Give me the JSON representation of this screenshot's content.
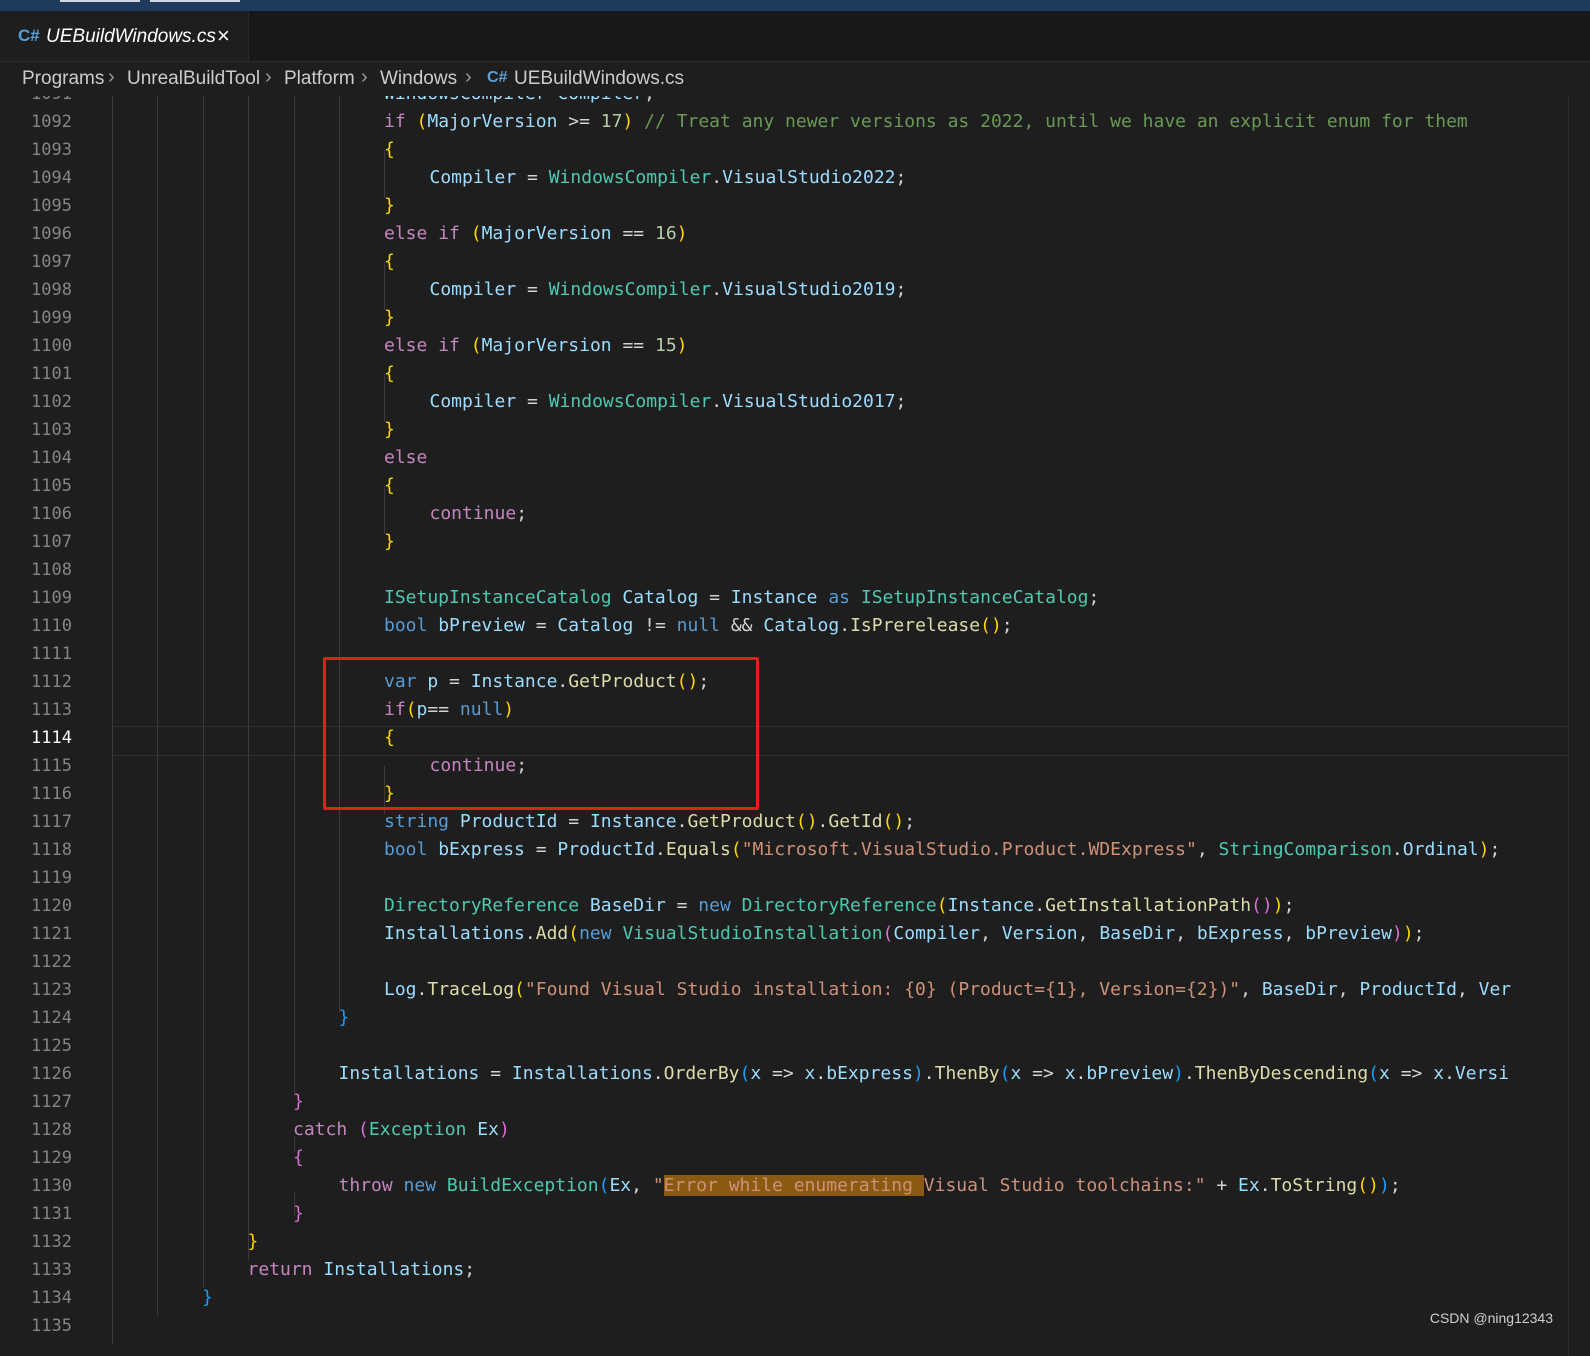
{
  "tab": {
    "name": "UEBuildWindows.cs",
    "language_badge": "C#",
    "close_symbol": "×"
  },
  "breadcrumb": {
    "items": [
      "Programs",
      "UnrealBuildTool",
      "Platform",
      "Windows",
      "UEBuildWindows.cs"
    ],
    "separator": "›",
    "file_badge": "C#"
  },
  "editor": {
    "active_line": 1114,
    "lines": [
      {
        "n": 1091,
        "indent": 0,
        "tokens": [
          [
            "id",
            "WindowsCompiler"
          ],
          [
            "pn",
            " "
          ],
          [
            "id",
            "Compiler"
          ],
          [
            "pn",
            ";"
          ]
        ]
      },
      {
        "n": 1092,
        "indent": 0,
        "tokens": [
          [
            "ctl",
            "if"
          ],
          [
            "pn",
            " "
          ],
          [
            "b1",
            "("
          ],
          [
            "id",
            "MajorVersion"
          ],
          [
            "pn",
            " >= "
          ],
          [
            "num",
            "17"
          ],
          [
            "b1",
            ")"
          ],
          [
            "pn",
            " "
          ],
          [
            "cm",
            "// Treat any newer versions as 2022, until we have an explicit enum for them"
          ]
        ]
      },
      {
        "n": 1093,
        "indent": 0,
        "tokens": [
          [
            "b1",
            "{"
          ]
        ]
      },
      {
        "n": 1094,
        "indent": 1,
        "tokens": [
          [
            "id",
            "Compiler"
          ],
          [
            "pn",
            " = "
          ],
          [
            "ty",
            "WindowsCompiler"
          ],
          [
            "pn",
            "."
          ],
          [
            "id",
            "VisualStudio2022"
          ],
          [
            "pn",
            ";"
          ]
        ]
      },
      {
        "n": 1095,
        "indent": 0,
        "tokens": [
          [
            "b1",
            "}"
          ]
        ]
      },
      {
        "n": 1096,
        "indent": 0,
        "tokens": [
          [
            "ctl",
            "else"
          ],
          [
            "pn",
            " "
          ],
          [
            "ctl",
            "if"
          ],
          [
            "pn",
            " "
          ],
          [
            "b1",
            "("
          ],
          [
            "id",
            "MajorVersion"
          ],
          [
            "pn",
            " == "
          ],
          [
            "num",
            "16"
          ],
          [
            "b1",
            ")"
          ]
        ]
      },
      {
        "n": 1097,
        "indent": 0,
        "tokens": [
          [
            "b1",
            "{"
          ]
        ]
      },
      {
        "n": 1098,
        "indent": 1,
        "tokens": [
          [
            "id",
            "Compiler"
          ],
          [
            "pn",
            " = "
          ],
          [
            "ty",
            "WindowsCompiler"
          ],
          [
            "pn",
            "."
          ],
          [
            "id",
            "VisualStudio2019"
          ],
          [
            "pn",
            ";"
          ]
        ]
      },
      {
        "n": 1099,
        "indent": 0,
        "tokens": [
          [
            "b1",
            "}"
          ]
        ]
      },
      {
        "n": 1100,
        "indent": 0,
        "tokens": [
          [
            "ctl",
            "else"
          ],
          [
            "pn",
            " "
          ],
          [
            "ctl",
            "if"
          ],
          [
            "pn",
            " "
          ],
          [
            "b1",
            "("
          ],
          [
            "id",
            "MajorVersion"
          ],
          [
            "pn",
            " == "
          ],
          [
            "num",
            "15"
          ],
          [
            "b1",
            ")"
          ]
        ]
      },
      {
        "n": 1101,
        "indent": 0,
        "tokens": [
          [
            "b1",
            "{"
          ]
        ]
      },
      {
        "n": 1102,
        "indent": 1,
        "tokens": [
          [
            "id",
            "Compiler"
          ],
          [
            "pn",
            " = "
          ],
          [
            "ty",
            "WindowsCompiler"
          ],
          [
            "pn",
            "."
          ],
          [
            "id",
            "VisualStudio2017"
          ],
          [
            "pn",
            ";"
          ]
        ]
      },
      {
        "n": 1103,
        "indent": 0,
        "tokens": [
          [
            "b1",
            "}"
          ]
        ]
      },
      {
        "n": 1104,
        "indent": 0,
        "tokens": [
          [
            "ctl",
            "else"
          ]
        ]
      },
      {
        "n": 1105,
        "indent": 0,
        "tokens": [
          [
            "b1",
            "{"
          ]
        ]
      },
      {
        "n": 1106,
        "indent": 1,
        "tokens": [
          [
            "ctl",
            "continue"
          ],
          [
            "pn",
            ";"
          ]
        ]
      },
      {
        "n": 1107,
        "indent": 0,
        "tokens": [
          [
            "b1",
            "}"
          ]
        ]
      },
      {
        "n": 1108,
        "indent": 0,
        "tokens": []
      },
      {
        "n": 1109,
        "indent": 0,
        "tokens": [
          [
            "ty",
            "ISetupInstanceCatalog"
          ],
          [
            "pn",
            " "
          ],
          [
            "id",
            "Catalog"
          ],
          [
            "pn",
            " = "
          ],
          [
            "id",
            "Instance"
          ],
          [
            "pn",
            " "
          ],
          [
            "kw",
            "as"
          ],
          [
            "pn",
            " "
          ],
          [
            "ty",
            "ISetupInstanceCatalog"
          ],
          [
            "pn",
            ";"
          ]
        ]
      },
      {
        "n": 1110,
        "indent": 0,
        "tokens": [
          [
            "kw",
            "bool"
          ],
          [
            "pn",
            " "
          ],
          [
            "id",
            "bPreview"
          ],
          [
            "pn",
            " = "
          ],
          [
            "id",
            "Catalog"
          ],
          [
            "pn",
            " != "
          ],
          [
            "kw",
            "null"
          ],
          [
            "pn",
            " && "
          ],
          [
            "id",
            "Catalog"
          ],
          [
            "pn",
            "."
          ],
          [
            "fn",
            "IsPrerelease"
          ],
          [
            "b1",
            "()"
          ],
          [
            "pn",
            ";"
          ]
        ]
      },
      {
        "n": 1111,
        "indent": 0,
        "tokens": []
      },
      {
        "n": 1112,
        "indent": 0,
        "tokens": [
          [
            "kw",
            "var"
          ],
          [
            "pn",
            " "
          ],
          [
            "id",
            "p"
          ],
          [
            "pn",
            " = "
          ],
          [
            "id",
            "Instance"
          ],
          [
            "pn",
            "."
          ],
          [
            "fn",
            "GetProduct"
          ],
          [
            "b1",
            "()"
          ],
          [
            "pn",
            ";"
          ]
        ]
      },
      {
        "n": 1113,
        "indent": 0,
        "tokens": [
          [
            "ctl",
            "if"
          ],
          [
            "b1",
            "("
          ],
          [
            "id",
            "p"
          ],
          [
            "pn",
            "== "
          ],
          [
            "kw",
            "null"
          ],
          [
            "b1",
            ")"
          ]
        ]
      },
      {
        "n": 1114,
        "indent": 0,
        "tokens": [
          [
            "b1",
            "{"
          ]
        ]
      },
      {
        "n": 1115,
        "indent": 1,
        "tokens": [
          [
            "ctl",
            "continue"
          ],
          [
            "pn",
            ";"
          ]
        ]
      },
      {
        "n": 1116,
        "indent": 0,
        "tokens": [
          [
            "b1",
            "}"
          ]
        ]
      },
      {
        "n": 1117,
        "indent": 0,
        "tokens": [
          [
            "kw",
            "string"
          ],
          [
            "pn",
            " "
          ],
          [
            "id",
            "ProductId"
          ],
          [
            "pn",
            " = "
          ],
          [
            "id",
            "Instance"
          ],
          [
            "pn",
            "."
          ],
          [
            "fn",
            "GetProduct"
          ],
          [
            "b1",
            "()"
          ],
          [
            "pn",
            "."
          ],
          [
            "fn",
            "GetId"
          ],
          [
            "b1",
            "()"
          ],
          [
            "pn",
            ";"
          ]
        ]
      },
      {
        "n": 1118,
        "indent": 0,
        "tokens": [
          [
            "kw",
            "bool"
          ],
          [
            "pn",
            " "
          ],
          [
            "id",
            "bExpress"
          ],
          [
            "pn",
            " = "
          ],
          [
            "id",
            "ProductId"
          ],
          [
            "pn",
            "."
          ],
          [
            "fn",
            "Equals"
          ],
          [
            "b1",
            "("
          ],
          [
            "str",
            "\"Microsoft.VisualStudio.Product.WDExpress\""
          ],
          [
            "pn",
            ", "
          ],
          [
            "ty",
            "StringComparison"
          ],
          [
            "pn",
            "."
          ],
          [
            "id",
            "Ordinal"
          ],
          [
            "b1",
            ")"
          ],
          [
            "pn",
            ";"
          ]
        ]
      },
      {
        "n": 1119,
        "indent": 0,
        "tokens": []
      },
      {
        "n": 1120,
        "indent": 0,
        "tokens": [
          [
            "ty",
            "DirectoryReference"
          ],
          [
            "pn",
            " "
          ],
          [
            "id",
            "BaseDir"
          ],
          [
            "pn",
            " = "
          ],
          [
            "kw",
            "new"
          ],
          [
            "pn",
            " "
          ],
          [
            "ty",
            "DirectoryReference"
          ],
          [
            "b1",
            "("
          ],
          [
            "id",
            "Instance"
          ],
          [
            "pn",
            "."
          ],
          [
            "fn",
            "GetInstallationPath"
          ],
          [
            "b2",
            "()"
          ],
          [
            "b1",
            ")"
          ],
          [
            "pn",
            ";"
          ]
        ]
      },
      {
        "n": 1121,
        "indent": 0,
        "tokens": [
          [
            "id",
            "Installations"
          ],
          [
            "pn",
            "."
          ],
          [
            "fn",
            "Add"
          ],
          [
            "b1",
            "("
          ],
          [
            "kw",
            "new"
          ],
          [
            "pn",
            " "
          ],
          [
            "ty",
            "VisualStudioInstallation"
          ],
          [
            "b2",
            "("
          ],
          [
            "id",
            "Compiler"
          ],
          [
            "pn",
            ", "
          ],
          [
            "id",
            "Version"
          ],
          [
            "pn",
            ", "
          ],
          [
            "id",
            "BaseDir"
          ],
          [
            "pn",
            ", "
          ],
          [
            "id",
            "bExpress"
          ],
          [
            "pn",
            ", "
          ],
          [
            "id",
            "bPreview"
          ],
          [
            "b2",
            ")"
          ],
          [
            "b1",
            ")"
          ],
          [
            "pn",
            ";"
          ]
        ]
      },
      {
        "n": 1122,
        "indent": 0,
        "tokens": []
      },
      {
        "n": 1123,
        "indent": 0,
        "tokens": [
          [
            "id",
            "Log"
          ],
          [
            "pn",
            "."
          ],
          [
            "fn",
            "TraceLog"
          ],
          [
            "b1",
            "("
          ],
          [
            "str",
            "\"Found Visual Studio installation: {0} (Product={1}, Version={2})\""
          ],
          [
            "pn",
            ", "
          ],
          [
            "id",
            "BaseDir"
          ],
          [
            "pn",
            ", "
          ],
          [
            "id",
            "ProductId"
          ],
          [
            "pn",
            ", "
          ],
          [
            "id",
            "Ver"
          ]
        ]
      },
      {
        "n": 1124,
        "indent": -1,
        "tokens": [
          [
            "b3",
            "}"
          ]
        ]
      },
      {
        "n": 1125,
        "indent": 0,
        "tokens": []
      },
      {
        "n": 1126,
        "indent": -1,
        "tokens": [
          [
            "id",
            "Installations"
          ],
          [
            "pn",
            " = "
          ],
          [
            "id",
            "Installations"
          ],
          [
            "pn",
            "."
          ],
          [
            "fn",
            "OrderBy"
          ],
          [
            "b3",
            "("
          ],
          [
            "id",
            "x"
          ],
          [
            "pn",
            " => "
          ],
          [
            "id",
            "x"
          ],
          [
            "pn",
            "."
          ],
          [
            "id",
            "bExpress"
          ],
          [
            "b3",
            ")"
          ],
          [
            "pn",
            "."
          ],
          [
            "fn",
            "ThenBy"
          ],
          [
            "b3",
            "("
          ],
          [
            "id",
            "x"
          ],
          [
            "pn",
            " => "
          ],
          [
            "id",
            "x"
          ],
          [
            "pn",
            "."
          ],
          [
            "id",
            "bPreview"
          ],
          [
            "b3",
            ")"
          ],
          [
            "pn",
            "."
          ],
          [
            "fn",
            "ThenByDescending"
          ],
          [
            "b3",
            "("
          ],
          [
            "id",
            "x"
          ],
          [
            "pn",
            " => "
          ],
          [
            "id",
            "x"
          ],
          [
            "pn",
            "."
          ],
          [
            "id",
            "Versi"
          ]
        ]
      },
      {
        "n": 1127,
        "indent": -2,
        "tokens": [
          [
            "b2",
            "}"
          ]
        ]
      },
      {
        "n": 1128,
        "indent": -2,
        "tokens": [
          [
            "ctl",
            "catch"
          ],
          [
            "pn",
            " "
          ],
          [
            "b2",
            "("
          ],
          [
            "ty",
            "Exception"
          ],
          [
            "pn",
            " "
          ],
          [
            "id",
            "Ex"
          ],
          [
            "b2",
            ")"
          ]
        ]
      },
      {
        "n": 1129,
        "indent": -2,
        "tokens": [
          [
            "b2",
            "{"
          ]
        ]
      },
      {
        "n": 1130,
        "indent": -1,
        "tokens": [
          [
            "ctl",
            "throw"
          ],
          [
            "pn",
            " "
          ],
          [
            "kw",
            "new"
          ],
          [
            "pn",
            " "
          ],
          [
            "ty",
            "BuildException"
          ],
          [
            "b3",
            "("
          ],
          [
            "id",
            "Ex"
          ],
          [
            "pn",
            ", "
          ],
          [
            "str",
            "\""
          ],
          [
            "strhl",
            "Error while enumerating "
          ],
          [
            "str",
            "Visual Studio toolchains:\""
          ],
          [
            "pn",
            " + "
          ],
          [
            "id",
            "Ex"
          ],
          [
            "pn",
            "."
          ],
          [
            "fn",
            "ToString"
          ],
          [
            "b1",
            "()"
          ],
          [
            "b3",
            ")"
          ],
          [
            "pn",
            ";"
          ]
        ]
      },
      {
        "n": 1131,
        "indent": -2,
        "tokens": [
          [
            "b2",
            "}"
          ]
        ]
      },
      {
        "n": 1132,
        "indent": -3,
        "tokens": [
          [
            "b1",
            "}"
          ]
        ]
      },
      {
        "n": 1133,
        "indent": -3,
        "tokens": [
          [
            "ctl",
            "return"
          ],
          [
            "pn",
            " "
          ],
          [
            "id",
            "Installations"
          ],
          [
            "pn",
            ";"
          ]
        ]
      },
      {
        "n": 1134,
        "indent": -4,
        "tokens": [
          [
            "b3",
            "}"
          ]
        ]
      },
      {
        "n": 1135,
        "indent": 0,
        "tokens": []
      }
    ]
  },
  "watermark": "CSDN @ning12343",
  "colors": {
    "background": "#1e1e1e",
    "highlight_box": "#e0201d",
    "search_highlight": "#8a5a12"
  }
}
